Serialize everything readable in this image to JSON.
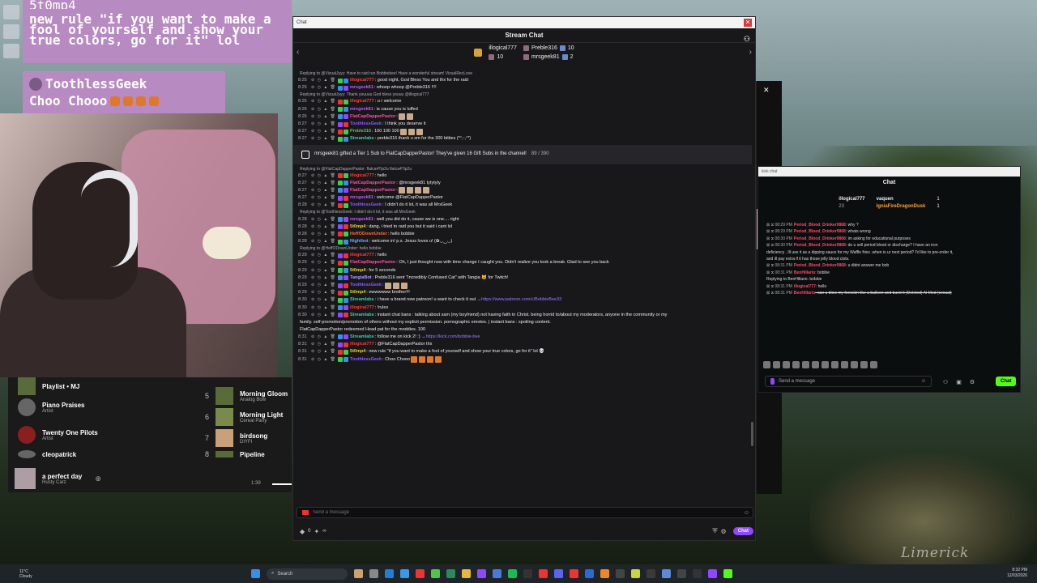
{
  "desktop": {
    "watermark": "Limerick"
  },
  "overlay1": {
    "username": "5t0mp4",
    "message": "new rule \"if you want to make a fool of yourself and show your true colors, go for it\" lol"
  },
  "overlay2": {
    "username": "ToothlessGeek",
    "message": "Choo Chooo"
  },
  "player": {
    "left": [
      {
        "title": "Playlist • MJ",
        "sub": ""
      },
      {
        "title": "Piano Praises",
        "sub": "Artist"
      },
      {
        "title": "Twenty One Pilots",
        "sub": "Artist"
      },
      {
        "title": "cleopatrick",
        "sub": ""
      }
    ],
    "right": [
      {
        "num": "5",
        "title": "Morning Gloom",
        "sub": "Analog Bow"
      },
      {
        "num": "6",
        "title": "Morning Light",
        "sub": "Cereal Party"
      },
      {
        "num": "7",
        "title": "birdsong",
        "sub": "DIYFI"
      },
      {
        "num": "8",
        "title": "Pipeline",
        "sub": ""
      }
    ],
    "now_playing": {
      "title": "a perfect day",
      "artist": "Rusty Carz"
    },
    "time": "1:39"
  },
  "chat": {
    "window_title": "Chat",
    "header": "Stream Chat",
    "gifters": [
      {
        "name": "illogical777",
        "count": "10"
      },
      {
        "name": "Preble316",
        "count": "10"
      },
      {
        "name": "mrsgeek81",
        "count": "2"
      }
    ],
    "messages": [
      {
        "kind": "reply",
        "text": "Replying to @VizualJyyy: Have to raid run Bobbiebee! Have a wonderful stream! VizualRecLove"
      },
      {
        "time": "8:25",
        "user": "illogical777",
        "color": "#ff3b3b",
        "text": ": good night, God Bless You and thx for the raid"
      },
      {
        "time": "8:25",
        "user": "mrsgeek81",
        "color": "#bf5af2",
        "text": ": whoop whoop @Preble316 !!!!"
      },
      {
        "kind": "reply",
        "text": "Replying to @VizualJyyy: Thank youuuu God bless youuu @illogical777"
      },
      {
        "time": "8:26",
        "user": "illogical777",
        "color": "#ff3b3b",
        "text": ": u r welcome"
      },
      {
        "time": "8:26",
        "user": "mrsgeek81",
        "color": "#bf5af2",
        "text": ": is cause you is luffed"
      },
      {
        "time": "8:26",
        "user": "FlatCapDapperPastor",
        "color": "#ff4da6",
        "text": ": ",
        "emotes": 2
      },
      {
        "time": "8:27",
        "user": "ToothlessGeek",
        "color": "#8a5cff",
        "text": ": I think you deserve it"
      },
      {
        "time": "8:27",
        "user": "Preble316",
        "color": "#5ac84a",
        "text": ": 100  100  100",
        "emotes": 3
      },
      {
        "time": "8:27",
        "user": "Streamlabs",
        "color": "#3ad1b0",
        "text": ": preble316 thank u sm for the 300 bitties (*ᐢ,ᵕ,ᐢ*)"
      },
      {
        "kind": "gift",
        "text": "mrsgeek81 gifted a Tier 1 Sub to FlatCapDapperPastor! They've given 16 Gift Subs in the channel!",
        "progress": "89 / 390"
      },
      {
        "kind": "reply",
        "text": "Replying to @FlatCapDapperPastor: flatca4Tip2u flatca4Tip2u"
      },
      {
        "time": "8:27",
        "user": "illogical777",
        "color": "#ff3b3b",
        "text": ": hello"
      },
      {
        "time": "8:27",
        "user": "FlatCapDapperPastor",
        "color": "#ff4da6",
        "text": ": @mrsgeek81 tytytyty"
      },
      {
        "time": "8:27",
        "user": "FlatCapDapperPastor",
        "color": "#ff4da6",
        "text": ": ",
        "emotes": 4
      },
      {
        "time": "8:27",
        "user": "mrsgeek81",
        "color": "#bf5af2",
        "text": ": welcome @FlatCapDapperPastor"
      },
      {
        "time": "8:28",
        "user": "ToothlessGeek",
        "color": "#8a5cff",
        "text": ": I didn't do it lol, it was all MrsGeek"
      },
      {
        "kind": "reply",
        "text": "Replying to @ToothlessGeek: I didn't do it lol, it was all MrsGeek"
      },
      {
        "time": "8:28",
        "user": "mrsgeek81",
        "color": "#bf5af2",
        "text": ": well you did do it, cause we is one.... right"
      },
      {
        "time": "8:28",
        "user": "5t0mp4",
        "color": "#e8d13a",
        "text": ": dang, i tried to raid you but it said i cant lol"
      },
      {
        "time": "8:28",
        "user": "HeffODownUnder",
        "color": "#ff6a3a",
        "text": ": hello bobbie"
      },
      {
        "time": "8:28",
        "user": "Nightbot",
        "color": "#6aa9ff",
        "text": ": welcome in! p.s. Jesus loves u! (✿◡‿◡)"
      },
      {
        "kind": "reply",
        "text": "Replying to @HeffODownUnder: hello bobbie"
      },
      {
        "time": "8:29",
        "user": "illogical777",
        "color": "#ff3b3b",
        "text": ": hello"
      },
      {
        "time": "8:29",
        "user": "FlatCapDapperPastor",
        "color": "#ff4da6",
        "text": ": Oh, I just thought now with time change I caught you. Didn't realize you took a break. Glad to see you back"
      },
      {
        "time": "8:29",
        "user": "5t0mp4",
        "color": "#e8d13a",
        "text": ": for 5 seconds"
      },
      {
        "time": "8:29",
        "user": "TangiaBot",
        "color": "#b0a0ff",
        "text": ": Preble316 sent \"Incredibly Confused Cat\" with Tangia 🐱 for Twitch!"
      },
      {
        "time": "8:29",
        "user": "ToothlessGeek",
        "color": "#8a5cff",
        "text": ": ",
        "emotes": 3
      },
      {
        "time": "8:29",
        "user": "5t0mp4",
        "color": "#e8d13a",
        "text": ": ewwwwww brother!!!"
      },
      {
        "time": "8:30",
        "user": "Streamlabs",
        "color": "#3ad1b0",
        "text": ": i have a brand new patreon! u want to check it out → ",
        "link": "https://www.patreon.com/c/BobbieBee33"
      },
      {
        "time": "8:30",
        "user": "illogical777",
        "color": "#ff3b3b",
        "text": ": !rules"
      },
      {
        "time": "8:30",
        "user": "Streamlabs",
        "color": "#3ad1b0",
        "text": ": instant chat bans : talking about sam (my boyfriend) not having faith in Christ. being horrid to/about my moderators, anyone in the community or my"
      },
      {
        "kind": "cont",
        "text": "family.  self-promotion/promotion of others without my explicit permission.  pornographic emotes. | instant bans : spoiling content."
      },
      {
        "kind": "sys",
        "text": "FlatCapDapperPastor redeemed Head pat for the moddies. 100"
      },
      {
        "time": "8:31",
        "user": "Streamlabs",
        "color": "#3ad1b0",
        "text": ": follow me on kick 2! :) → ",
        "link": "https://kick.com/bobbie-bee"
      },
      {
        "time": "8:31",
        "user": "illogical777",
        "color": "#ff3b3b",
        "text": ": @FlatCapDapperPastor thx"
      },
      {
        "time": "8:31",
        "user": "5t0mp4",
        "color": "#e8d13a",
        "text": ": new rule \"if you want to make a fool of yourself and show your true colors, go for it\" lol 💀"
      },
      {
        "time": "8:31",
        "user": "ToothlessGeek",
        "color": "#8a5cff",
        "text": ": Choo Chooo",
        "emotes": 4,
        "orange": true
      }
    ],
    "input_placeholder": "Send a message",
    "points": "0",
    "infinity": "∞",
    "send_label": "Chat"
  },
  "kick": {
    "window_title": "kick chat",
    "title": "Chat",
    "leaders": [
      {
        "name": "illogical777",
        "sub": "23"
      },
      {
        "name": "vaquen",
        "count": "1"
      },
      {
        "name": "IgniaFireDragonDusk",
        "count": "1"
      }
    ],
    "messages": [
      {
        "time": "08:29 PM",
        "user": "Period_Blood_Drinker9868",
        "text": ": why ?"
      },
      {
        "time": "08:29 PM",
        "user": "Period_Blood_Drinker9868",
        "text": ": whats wrong"
      },
      {
        "time": "08:30 PM",
        "user": "Period_Blood_Drinker9868",
        "text": ": im asking for educational purposes"
      },
      {
        "time": "08:30 PM",
        "user": "Period_Blood_Drinker9868",
        "text": ": do u sell period blood or discharge? I have an iron"
      },
      {
        "time": "",
        "user": "",
        "text": "deficiency , Ill use it as a dipping sauce for my Waffle fries .when is ur next period? I'd like to pre-order it,"
      },
      {
        "time": "",
        "user": "",
        "text": "and ill pay extra if it has those jelly blood clots."
      },
      {
        "time": "08:31 PM",
        "user": "Period_Blood_Drinker9868",
        "text": ": u didnt answer me bob"
      },
      {
        "time": "08:31 PM",
        "user": "BenHillario",
        "text": ": bobbie"
      },
      {
        "time": "",
        "user": "",
        "text": "Replying to BenHillario: bobbie"
      },
      {
        "time": "08:31 PM",
        "user": "illogical777",
        "text": ": hello"
      },
      {
        "time": "08:31 PM",
        "user": "BenHillario",
        "text": ": can u blow my foreskin like a balloon and burst it (Deleted) AI Mod (sexual)"
      }
    ],
    "input_placeholder": "Send a message",
    "send_label": "Chat"
  },
  "taskbar": {
    "weather_temp": "11°C",
    "weather_desc": "Cloudy",
    "search_placeholder": "Search",
    "time": "8:32 PM",
    "date": "12/03/2026"
  }
}
